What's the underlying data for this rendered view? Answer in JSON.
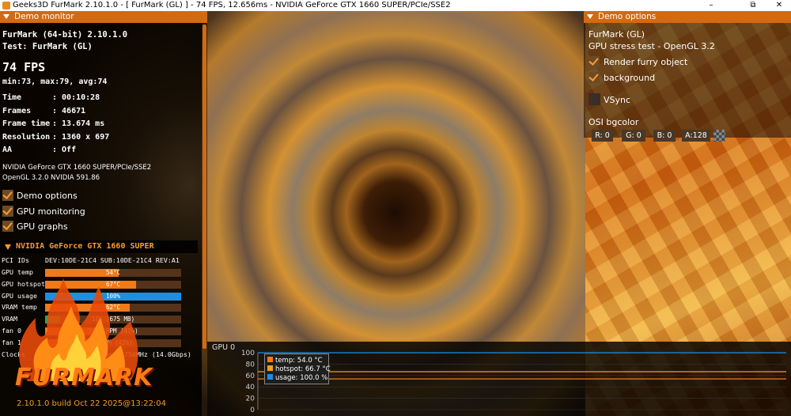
{
  "window": {
    "title": "Geeks3D FurMark 2.10.1.0 - [ FurMark (GL) ] - 74 FPS, 12.656ms - NVIDIA GeForce GTX 1660 SUPER/PCIe/SSE2",
    "minimize": "–",
    "maximize": "⧉",
    "close": "✕"
  },
  "left_panel": {
    "header": "Demo monitor",
    "app_name": "FurMark (64-bit) 2.10.1.0",
    "test": "Test: FurMark (GL)",
    "fps": "74 FPS",
    "fps_stats": "min:73, max:79, avg:74",
    "stats": [
      {
        "label": "Time",
        "value": ": 00:10:28"
      },
      {
        "label": "Frames",
        "value": ": 46671"
      },
      {
        "label": "Frame time",
        "value": ": 13.674 ms"
      },
      {
        "label": "Resolution",
        "value": ": 1360 x 697"
      },
      {
        "label": "AA",
        "value": ": Off"
      }
    ],
    "gpu_name": "NVIDIA GeForce GTX 1660 SUPER/PCIe/SSE2",
    "opengl": "OpenGL 3.2.0 NVIDIA 591.86",
    "checkboxes": [
      {
        "label": "Demo options",
        "checked": true
      },
      {
        "label": "GPU monitoring",
        "checked": true
      },
      {
        "label": "GPU graphs",
        "checked": true
      }
    ]
  },
  "gpu_monitor": {
    "header": "NVIDIA GeForce GTX 1660 SUPER",
    "pci_label": "PCI IDs",
    "pci_value": "DEV:10DE-21C4 SUB:10DE-21C4 REV:A1",
    "bars": [
      {
        "label": "GPU temp",
        "text": "54°C",
        "fraction": 0.54,
        "color": "#f07a1a"
      },
      {
        "label": "GPU hotspot",
        "text": "67°C",
        "fraction": 0.67,
        "color": "#f07a1a"
      },
      {
        "label": "GPU usage",
        "text": "100%",
        "fraction": 1.0,
        "color": "#1e8ee0"
      },
      {
        "label": "VRAM temp",
        "text": "62°C",
        "fraction": 0.62,
        "color": "#f07a1a"
      },
      {
        "label": "VRAM",
        "text": "11% (675 MB)",
        "fraction": 0.11,
        "color": "#2ea84a"
      },
      {
        "label": "fan 0",
        "text": "1460 RPM (42%)",
        "fraction": 0.42,
        "color": "#f07a1a"
      },
      {
        "label": "fan 1",
        "text": "0 RPM (42%)",
        "fraction": 0.42,
        "color": "#f07a1a"
      }
    ],
    "clocks_label": "Clocks",
    "clocks_value": "core:1770MHz - mem:1750MHz (14.0Gbps)"
  },
  "logo_text": "FURMARK",
  "version": "2.10.1.0 build Oct 22 2025@13:22:04",
  "right_panel": {
    "header": "Demo options",
    "demo_name": "FurMark (GL)",
    "demo_desc": "GPU stress test - OpenGL 3.2",
    "checkboxes": [
      {
        "label": "Render furry object",
        "checked": true
      },
      {
        "label": "background",
        "checked": true
      },
      {
        "label": "VSync",
        "checked": false
      }
    ],
    "osi_label": "OSI bgcolor",
    "osi_r": "R: 0",
    "osi_g": "G: 0",
    "osi_b": "B: 0",
    "osi_a": "A:128"
  },
  "graph": {
    "title": "GPU 0",
    "y_ticks": [
      "100",
      "80",
      "60",
      "40",
      "20",
      "0"
    ],
    "legend": [
      {
        "label": "temp: 54.0 °C",
        "color": "#f07a1a"
      },
      {
        "label": "hotspot: 66.7 °C",
        "color": "#f0a020"
      },
      {
        "label": "usage: 100.0 %",
        "color": "#1e8ee0"
      }
    ],
    "series_values": {
      "temp": 54.0,
      "hotspot": 66.7,
      "usage": 100.0
    }
  }
}
